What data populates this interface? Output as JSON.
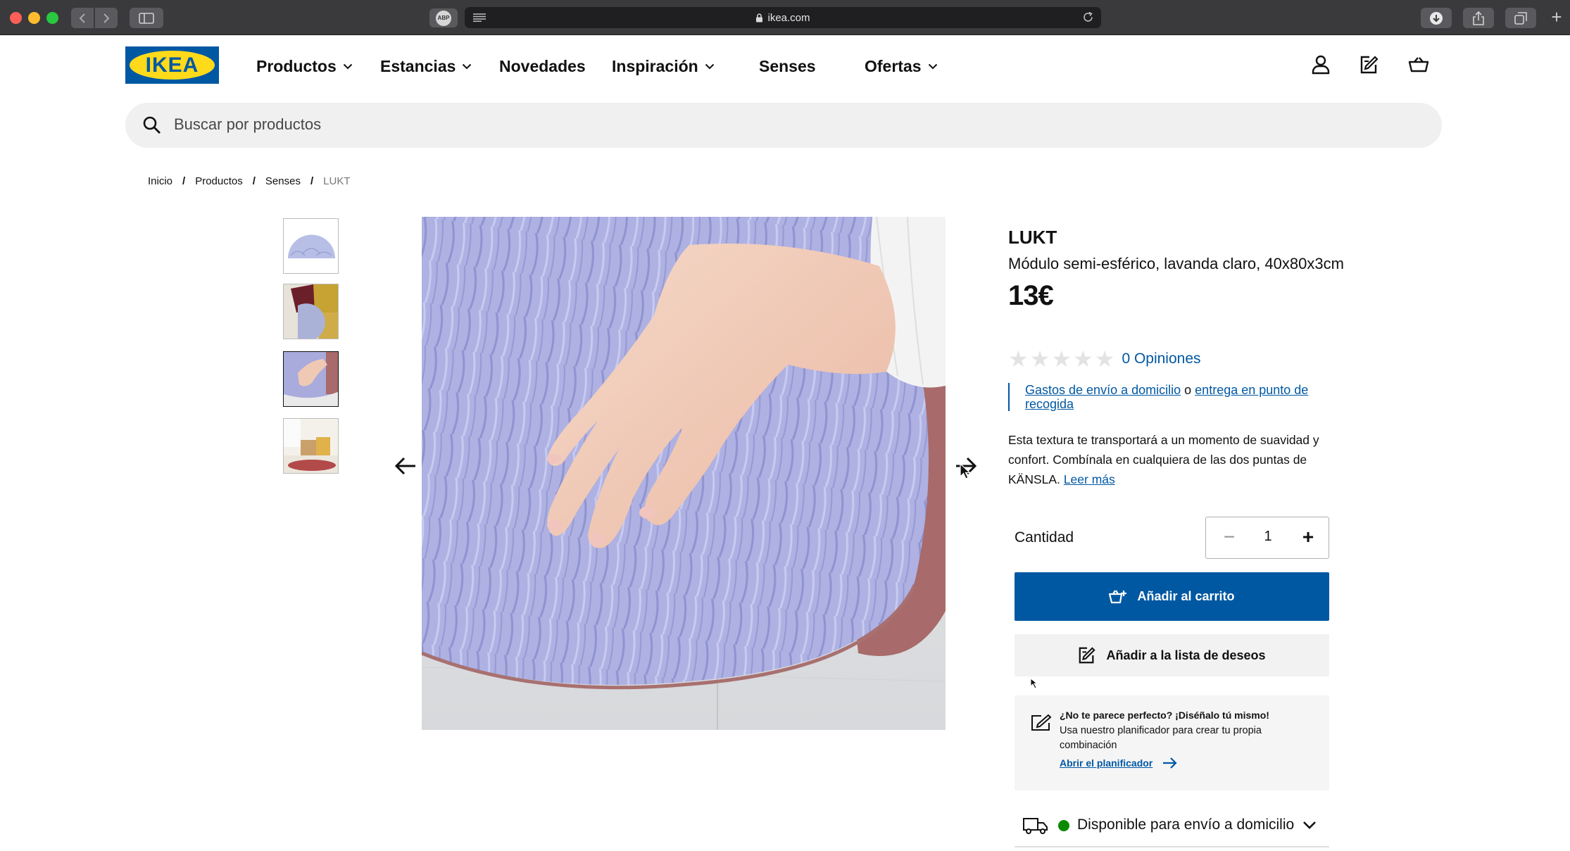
{
  "browser": {
    "url": "ikea.com",
    "adblock_label": "ABP"
  },
  "header": {
    "logo_text": "IKEA",
    "nav": [
      {
        "label": "Productos",
        "has_dropdown": true
      },
      {
        "label": "Estancias",
        "has_dropdown": true
      },
      {
        "label": "Novedades",
        "has_dropdown": false
      },
      {
        "label": "Inspiración",
        "has_dropdown": true
      },
      {
        "label": "Senses",
        "has_dropdown": false
      },
      {
        "label": "Ofertas",
        "has_dropdown": true
      }
    ],
    "icons": [
      "user-icon",
      "wishlist-icon",
      "cart-icon"
    ]
  },
  "search": {
    "placeholder": "Buscar por productos"
  },
  "breadcrumb": {
    "items": [
      "Inicio",
      "Productos",
      "Senses"
    ],
    "current": "LUKT",
    "separator": "/"
  },
  "gallery": {
    "thumbnail_count": 4,
    "active_index": 2
  },
  "product": {
    "name": "LUKT",
    "description": "Módulo semi-esférico, lavanda claro, 40x80x3cm",
    "price": "13€",
    "rating_stars": 0,
    "reviews_label": "0 Opiniones",
    "delivery_link_1": "Gastos de envío a domicilio",
    "delivery_or": "o",
    "delivery_link_2": "entrega en punto de recogida",
    "body_text": "Esta textura te transportará a un momento de suavidad y confort. Combínala en cualquiera de las dos puntas de KÄNSLA.",
    "read_more": "Leer más"
  },
  "purchase": {
    "quantity_label": "Cantidad",
    "quantity_value": "1",
    "minus": "−",
    "plus": "+",
    "add_to_cart": "Añadir al carrito",
    "add_to_wishlist": "Añadir a la lista de deseos"
  },
  "planner": {
    "title": "¿No te parece perfecto? ¡Diséñalo tú mismo!",
    "text": "Usa nuestro planificador para crear tu propia combinación",
    "link": "Abrir el planificador"
  },
  "availability": {
    "text": "Disponible para envío a domicilio",
    "status_color": "#0a8a00"
  },
  "colors": {
    "ikea_blue": "#0058a3",
    "ikea_yellow": "#ffda1a"
  }
}
